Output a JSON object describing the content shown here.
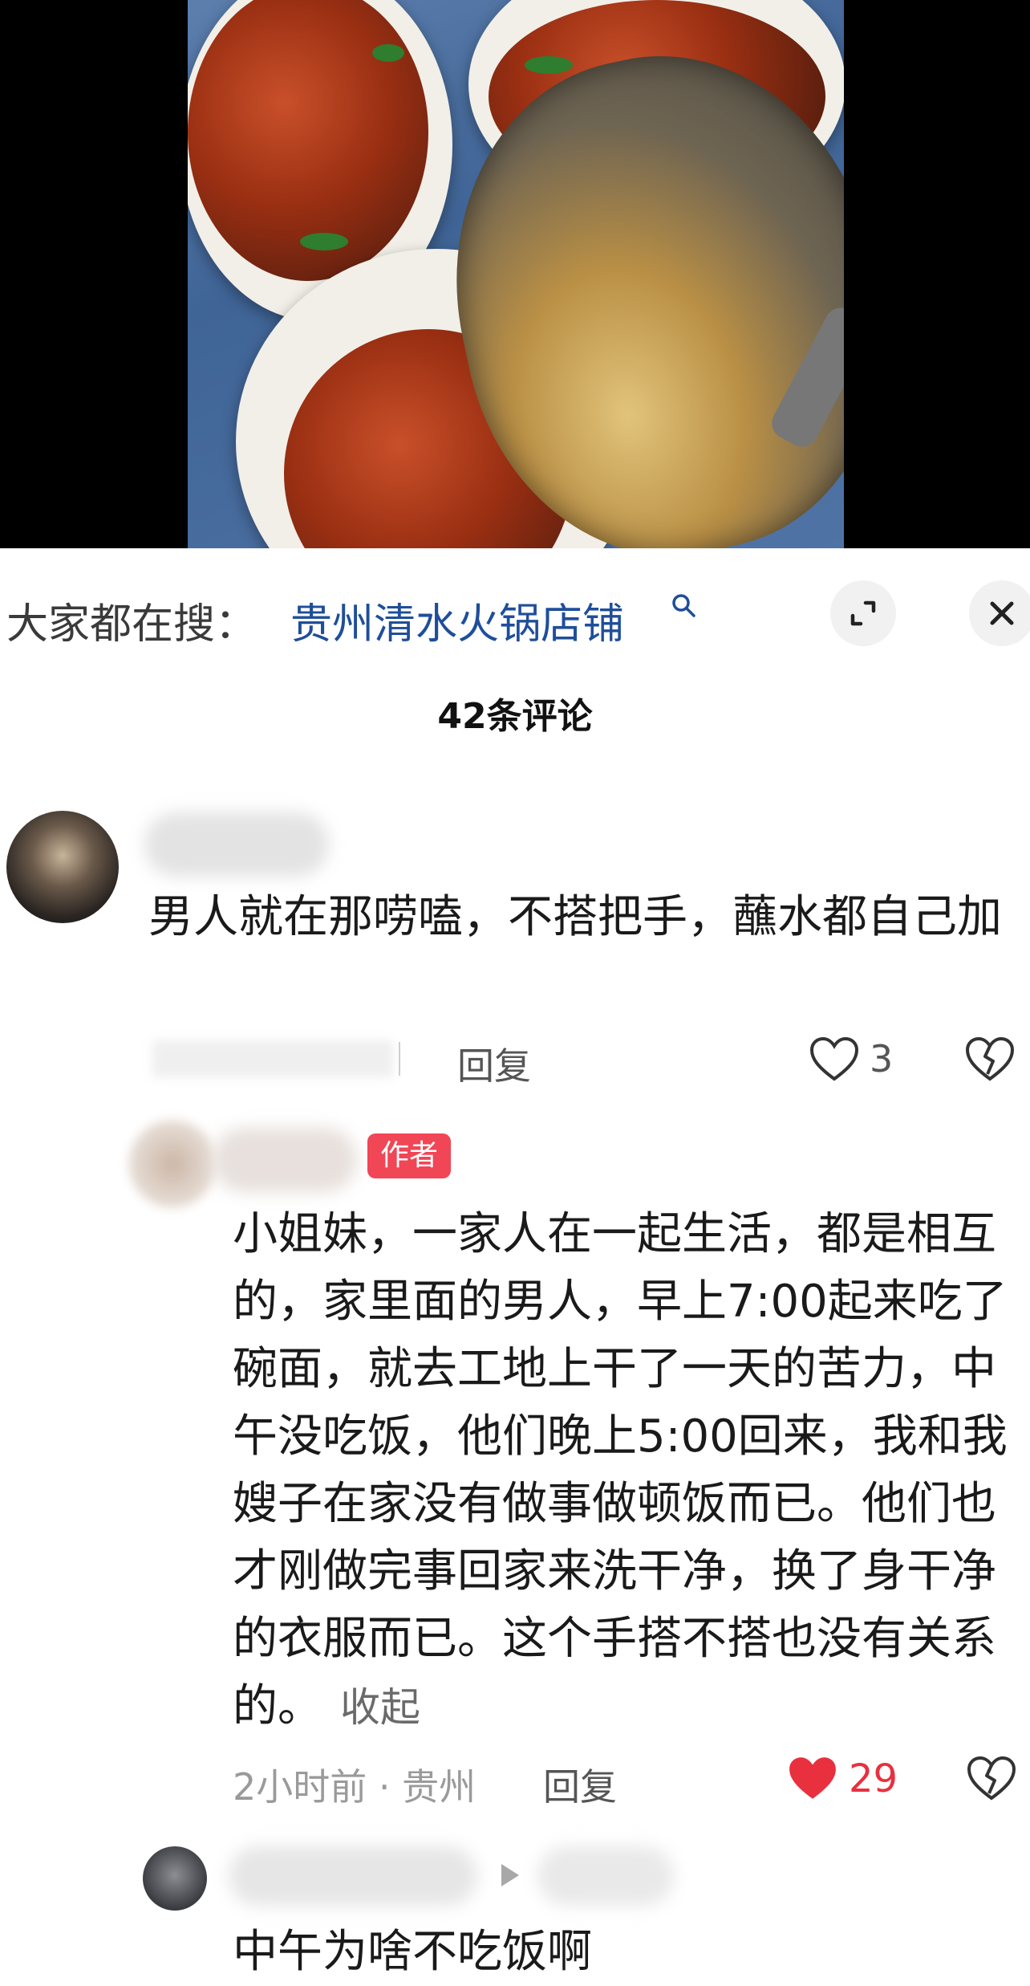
{
  "search": {
    "prefix": "大家都在搜：",
    "keyword": "贵州清水火锅店铺",
    "icon": "search-icon"
  },
  "comments_header": {
    "count_label": "42条评论"
  },
  "comments": [
    {
      "text": "男人就在那唠嗑，不搭把手，蘸水都自己加",
      "reply_label": "回复",
      "likes": "3"
    },
    {
      "badge": "作者",
      "text": "小姐妹，一家人在一起生活，都是相互的，家里面的男人，早上7:00起来吃了碗面，就去工地上干了一天的苦力，中午没吃饭，他们晚上5:00回来，我和我嫂子在家没有做事做顿饭而已。他们也才刚做完事回家来洗干净，换了身干净的衣服而已。这个手搭不搭也没有关系的。",
      "collapse_label": "收起",
      "time_location": "2小时前 · 贵州",
      "reply_label": "回复",
      "likes": "29",
      "liked_color": "#e8303f"
    },
    {
      "text": "中午为啥不吃饭啊"
    }
  ],
  "colors": {
    "link_blue": "#1f4e9a",
    "author_badge": "#f04656"
  }
}
